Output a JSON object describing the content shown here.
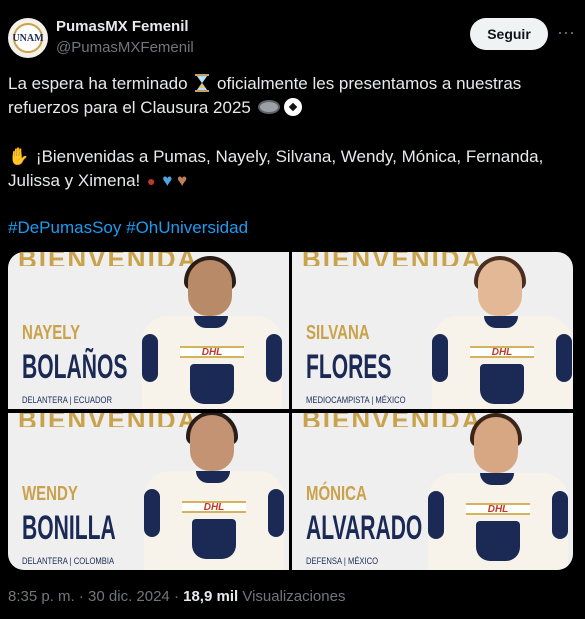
{
  "account": {
    "name": "PumasMX Femenil",
    "handle": "@PumasMXFemenil",
    "avatar_icon": "pumas-femenil-logo",
    "follow_label": "Seguir",
    "more_label": "···"
  },
  "post": {
    "line1_a": "La espera ha terminado",
    "line1_b": "oficialmente les presentamos a nuestras",
    "line2": "refuerzos para el Clausura 2025",
    "line3": "¡Bienvenidas a Pumas, Nayely, Silvana, Wendy, Mónica, Fernanda,",
    "line4": "Julissa y Ximena!",
    "hashtags": [
      "#DePumasSoy",
      "#OhUniversidad"
    ]
  },
  "media": {
    "banner_text": "BIENVENIDA",
    "cards": [
      {
        "first": "NAYELY",
        "last": "BOLAÑOS",
        "role": "DELANTERA | ECUADOR"
      },
      {
        "first": "SILVANA",
        "last": "FLORES",
        "role": "MEDIOCAMPISTA | MÉXICO"
      },
      {
        "first": "WENDY",
        "last": "BONILLA",
        "role": "DELANTERA | COLOMBIA"
      },
      {
        "first": "MÓNICA",
        "last": "ALVARADO",
        "role": "DEFENSA | MÉXICO"
      }
    ],
    "sponsor_text": "DHL"
  },
  "meta": {
    "time": "8:35 p. m.",
    "sep1": " · ",
    "date": "30 dic. 2024",
    "sep2": " · ",
    "views_count": "18,9 mil",
    "views_label": " Visualizaciones"
  },
  "colors": {
    "background": "#000000",
    "text": "#e7e9ea",
    "muted": "#71767b",
    "link": "#1d9bf0",
    "gold": "#c9a24b",
    "navy": "#1b2a55"
  }
}
